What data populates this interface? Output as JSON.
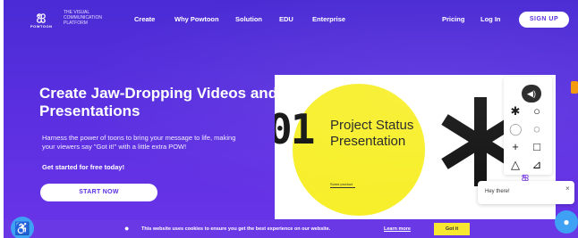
{
  "nav": {
    "logo_word": "POWTOON",
    "tagline": "THE VISUAL COMMUNICATION PLATFORM",
    "links": [
      "Create",
      "Why Powtoon",
      "Solution",
      "EDU",
      "Enterprise"
    ],
    "pricing": "Pricing",
    "login": "Log In",
    "signup": "SIGN UP"
  },
  "hero": {
    "title": "Create Jaw-Dropping Videos and Presentations",
    "subtitle": "Harness the power of toons to bring your message to life, making your viewers say \"Got it!\" with a little extra POW!",
    "cta_text": "Get started for free today!",
    "start_button": "START NOW"
  },
  "mockup": {
    "big_number": "01",
    "slide_title": "Project Status Presentation",
    "slide_small": "Some product"
  },
  "chat": {
    "message": "Hey there!",
    "close": "×"
  },
  "cookie": {
    "text": "This website uses cookies to ensure you get the best experience on our website.",
    "learn_more": "Learn more",
    "button": "Got it"
  },
  "colors": {
    "brand": "#5a2fe0",
    "accent_yellow": "#f7ef2a",
    "chat_blue": "#3fa1f4"
  },
  "icons": [
    "logo-icon",
    "speaker-icon",
    "asterisk-icon",
    "circle-icon",
    "plus-icon",
    "square-icon",
    "triangle-icon",
    "accessibility-icon",
    "cookie-icon",
    "chat-icon",
    "close-icon"
  ]
}
